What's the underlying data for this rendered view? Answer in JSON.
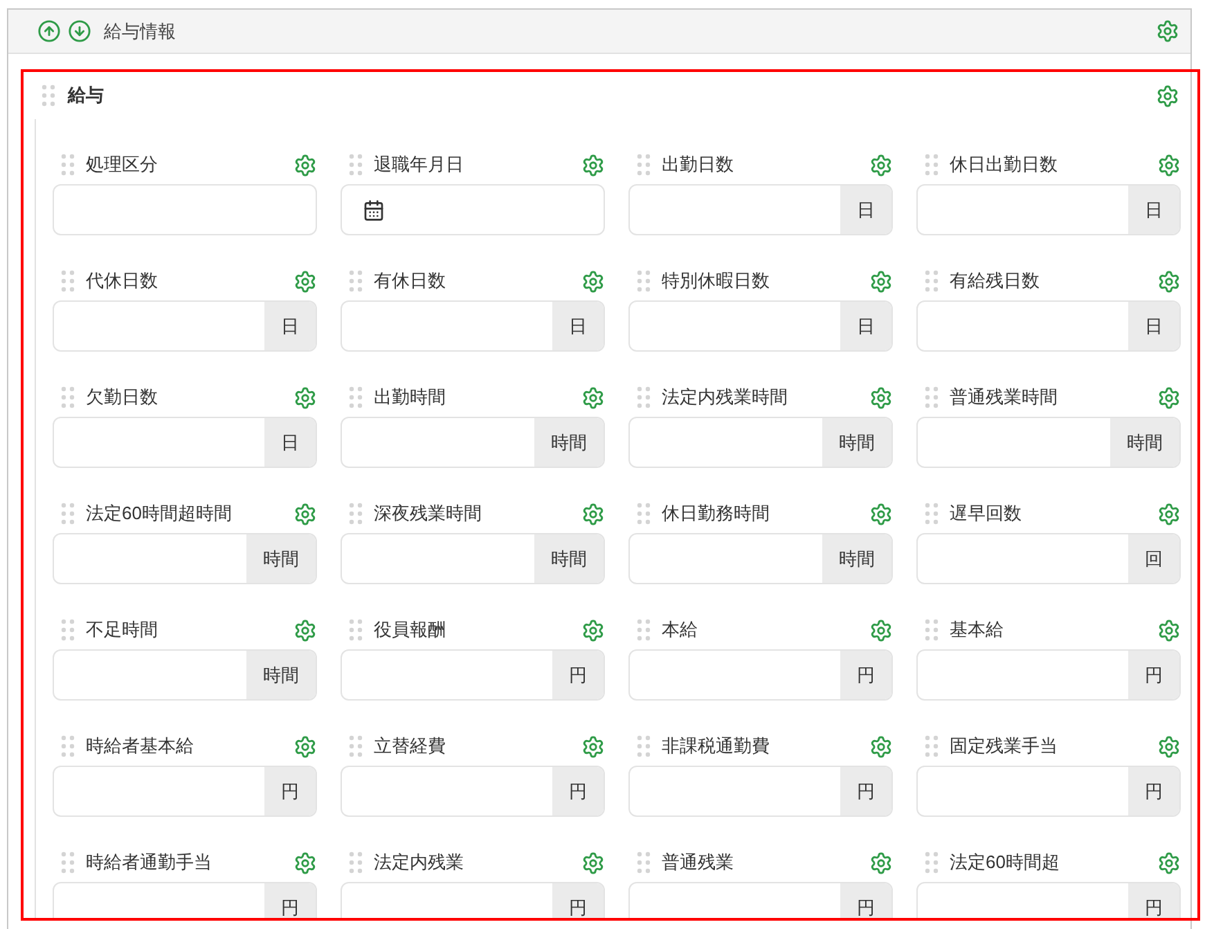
{
  "panel": {
    "title": "給与情報"
  },
  "section": {
    "title": "給与",
    "fields": [
      {
        "label": "処理区分",
        "kind": "text"
      },
      {
        "label": "退職年月日",
        "kind": "date"
      },
      {
        "label": "出勤日数",
        "kind": "unit",
        "unit": "日"
      },
      {
        "label": "休日出勤日数",
        "kind": "unit",
        "unit": "日"
      },
      {
        "label": "代休日数",
        "kind": "unit",
        "unit": "日"
      },
      {
        "label": "有休日数",
        "kind": "unit",
        "unit": "日"
      },
      {
        "label": "特別休暇日数",
        "kind": "unit",
        "unit": "日"
      },
      {
        "label": "有給残日数",
        "kind": "unit",
        "unit": "日"
      },
      {
        "label": "欠勤日数",
        "kind": "unit",
        "unit": "日"
      },
      {
        "label": "出勤時間",
        "kind": "unit",
        "unit": "時間"
      },
      {
        "label": "法定内残業時間",
        "kind": "unit",
        "unit": "時間"
      },
      {
        "label": "普通残業時間",
        "kind": "unit",
        "unit": "時間"
      },
      {
        "label": "法定60時間超時間",
        "kind": "unit",
        "unit": "時間"
      },
      {
        "label": "深夜残業時間",
        "kind": "unit",
        "unit": "時間"
      },
      {
        "label": "休日勤務時間",
        "kind": "unit",
        "unit": "時間"
      },
      {
        "label": "遅早回数",
        "kind": "unit",
        "unit": "回"
      },
      {
        "label": "不足時間",
        "kind": "unit",
        "unit": "時間"
      },
      {
        "label": "役員報酬",
        "kind": "unit",
        "unit": "円"
      },
      {
        "label": "本給",
        "kind": "unit",
        "unit": "円"
      },
      {
        "label": "基本給",
        "kind": "unit",
        "unit": "円"
      },
      {
        "label": "時給者基本給",
        "kind": "unit",
        "unit": "円"
      },
      {
        "label": "立替経費",
        "kind": "unit",
        "unit": "円"
      },
      {
        "label": "非課税通勤費",
        "kind": "unit",
        "unit": "円"
      },
      {
        "label": "固定残業手当",
        "kind": "unit",
        "unit": "円"
      },
      {
        "label": "時給者通勤手当",
        "kind": "unit",
        "unit": "円"
      },
      {
        "label": "法定内残業",
        "kind": "unit",
        "unit": "円"
      },
      {
        "label": "普通残業",
        "kind": "unit",
        "unit": "円"
      },
      {
        "label": "法定60時間超",
        "kind": "unit",
        "unit": "円"
      }
    ]
  }
}
